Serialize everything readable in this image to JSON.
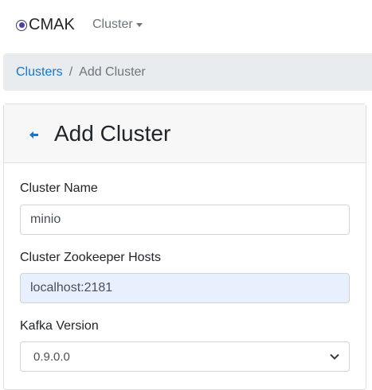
{
  "navbar": {
    "brand": "CMAK",
    "brand_icon": "target-circle-icon",
    "dropdown_label": "Cluster"
  },
  "breadcrumb": {
    "link": "Clusters",
    "separator": "/",
    "active": "Add Cluster"
  },
  "card": {
    "title": "Add Cluster",
    "back_icon": "left-arrow-icon"
  },
  "form": {
    "cluster_name_label": "Cluster Name",
    "cluster_name_value": "minio",
    "zk_hosts_label": "Cluster Zookeeper Hosts",
    "zk_hosts_value": "localhost:2181",
    "kafka_version_label": "Kafka Version",
    "kafka_version_value": "0.9.0.0"
  },
  "colors": {
    "link": "#1a73c9",
    "breadcrumb_bg": "#e9ecef",
    "autofill_bg": "#e8f0fe"
  }
}
